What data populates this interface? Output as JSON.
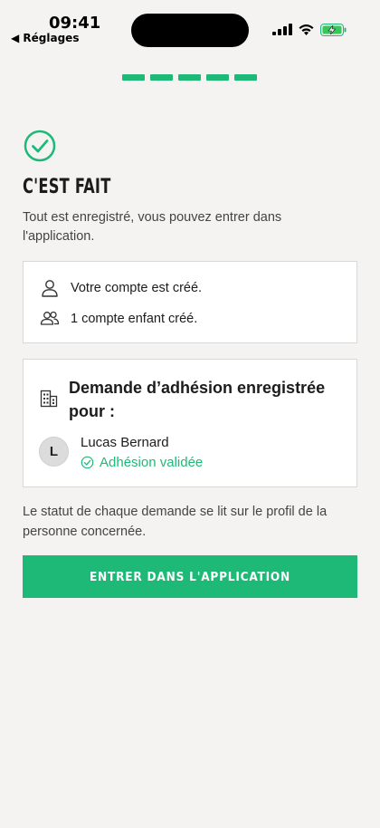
{
  "status_bar": {
    "time": "09:41",
    "back_label": "◀ Réglages"
  },
  "progress": {
    "total_steps": 5,
    "completed_steps": 5,
    "color": "#1fb977"
  },
  "header": {
    "title": "C'EST FAIT",
    "subtitle": "Tout est enregistré, vous pouvez entrer dans l'application."
  },
  "summary": {
    "items": [
      {
        "icon": "user-icon",
        "label": "Votre compte est créé."
      },
      {
        "icon": "users-icon",
        "label": "1 compte enfant créé."
      }
    ]
  },
  "demande": {
    "icon": "building-icon",
    "title": "Demande d’adhésion enregistrée pour :",
    "person": {
      "initial": "L",
      "name": "Lucas Bernard",
      "status": "Adhésion validée",
      "status_color": "#1fb977"
    }
  },
  "note": "Le statut de chaque demande se lit sur le profil de la personne concernée.",
  "cta_label": "ENTRER DANS L'APPLICATION",
  "accent_color": "#1fb977"
}
